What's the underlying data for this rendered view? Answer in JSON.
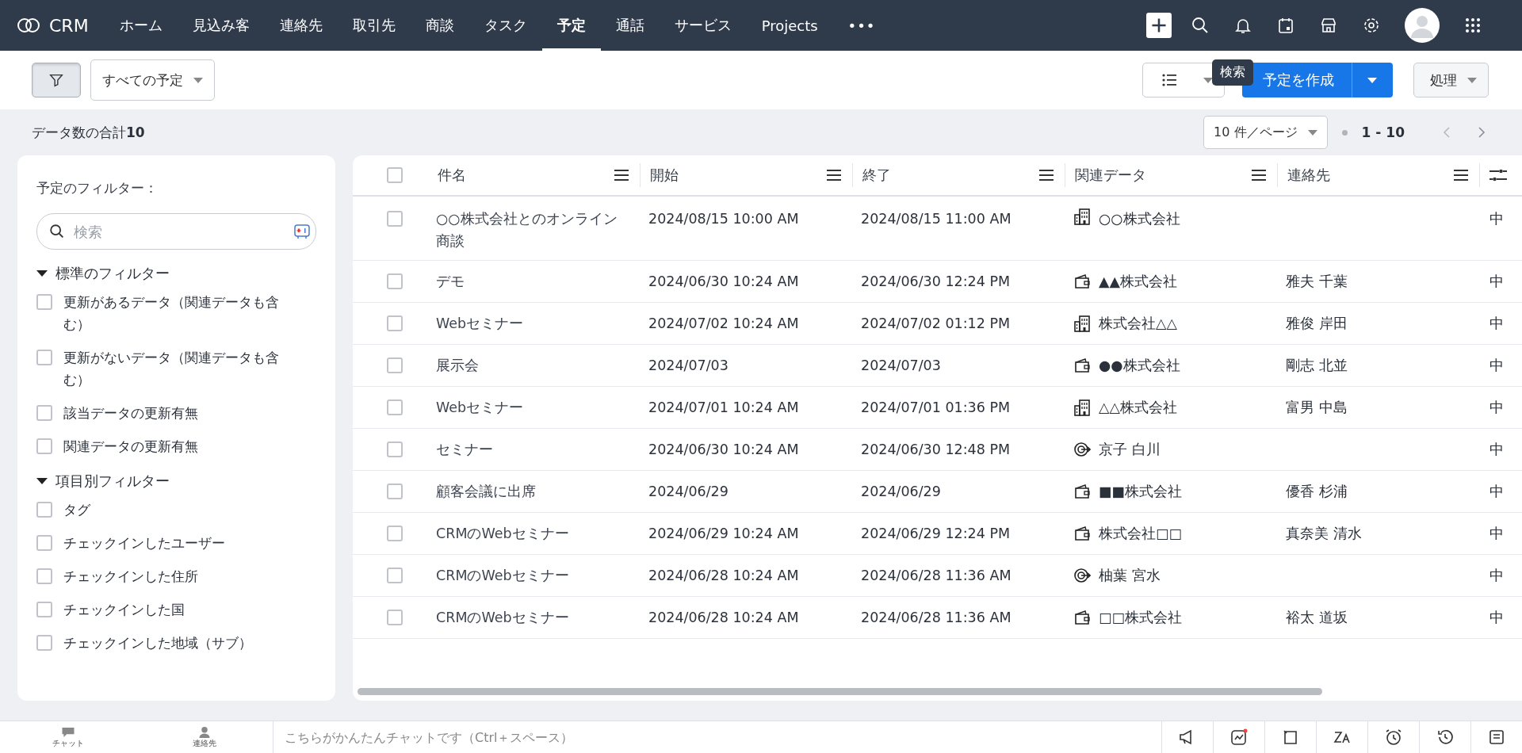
{
  "nav": {
    "logo": "CRM",
    "items": [
      {
        "label": "ホーム",
        "selected": false
      },
      {
        "label": "見込み客",
        "selected": false
      },
      {
        "label": "連絡先",
        "selected": false
      },
      {
        "label": "取引先",
        "selected": false
      },
      {
        "label": "商談",
        "selected": false
      },
      {
        "label": "タスク",
        "selected": false
      },
      {
        "label": "予定",
        "selected": true
      },
      {
        "label": "通話",
        "selected": false
      },
      {
        "label": "サービス",
        "selected": false
      },
      {
        "label": "Projects",
        "selected": false
      }
    ],
    "more": "•••"
  },
  "toolbar": {
    "view_select": "すべての予定",
    "tooltip": "検索",
    "create_button": "予定を作成",
    "actions_button": "処理"
  },
  "summary": {
    "label": "データ数の合計",
    "count": "10",
    "per_page": "10 件／ページ",
    "range": "1 - 10"
  },
  "sidebar": {
    "title": "予定のフィルター：",
    "search": {
      "placeholder": "検索"
    },
    "sections": [
      {
        "title": "標準のフィルター",
        "expanded": true,
        "items": [
          {
            "label": "更新があるデータ（関連データも含む）",
            "checked": false
          },
          {
            "label": "更新がないデータ（関連データも含む）",
            "checked": false
          },
          {
            "label": "該当データの更新有無",
            "checked": false
          },
          {
            "label": "関連データの更新有無",
            "checked": false
          }
        ]
      },
      {
        "title": "項目別フィルター",
        "expanded": true,
        "items": [
          {
            "label": "タグ",
            "checked": false
          },
          {
            "label": "チェックインしたユーザー",
            "checked": false
          },
          {
            "label": "チェックインした住所",
            "checked": false
          },
          {
            "label": "チェックインした国",
            "checked": false
          },
          {
            "label": "チェックインした地域（サブ）",
            "checked": false
          }
        ]
      }
    ]
  },
  "table": {
    "columns": [
      "件名",
      "開始",
      "終了",
      "関連データ",
      "連絡先"
    ],
    "all_checked": false,
    "rows": [
      {
        "checked": false,
        "title": "○○株式会社とのオンライン商談",
        "start": "2024/08/15 10:00 AM",
        "end": "2024/08/15 11:00 AM",
        "related": {
          "kind": "building",
          "label": "○○株式会社"
        },
        "contact": "",
        "column_7": "中"
      },
      {
        "checked": false,
        "title": "デモ",
        "start": "2024/06/30 10:24 AM",
        "end": "2024/06/30 12:24 PM",
        "related": {
          "kind": "wallet",
          "label": "▲▲株式会社"
        },
        "contact": "雅夫 千葉",
        "column_7": "中"
      },
      {
        "checked": false,
        "title": "Webセミナー",
        "start": "2024/07/02 10:24 AM",
        "end": "2024/07/02 01:12 PM",
        "related": {
          "kind": "building",
          "label": "株式会社△△"
        },
        "contact": "雅俊 岸田",
        "column_7": "中"
      },
      {
        "checked": false,
        "title": "展示会",
        "start": "2024/07/03",
        "end": "2024/07/03",
        "related": {
          "kind": "wallet",
          "label": "●●株式会社"
        },
        "contact": "剛志 北並",
        "column_7": "中"
      },
      {
        "checked": false,
        "title": "Webセミナー",
        "start": "2024/07/01 10:24 AM",
        "end": "2024/07/01 01:36 PM",
        "related": {
          "kind": "building",
          "label": "△△株式会社"
        },
        "contact": "富男 中島",
        "column_7": "中"
      },
      {
        "checked": false,
        "title": "セミナー",
        "start": "2024/06/30 10:24 AM",
        "end": "2024/06/30 12:48 PM",
        "related": {
          "kind": "target",
          "label": "京子 白川"
        },
        "contact": "",
        "column_7": "中"
      },
      {
        "checked": false,
        "title": "顧客会議に出席",
        "start": "2024/06/29",
        "end": "2024/06/29",
        "related": {
          "kind": "wallet",
          "label": "■■株式会社"
        },
        "contact": "優香 杉浦",
        "column_7": "中"
      },
      {
        "checked": false,
        "title": "CRMのWebセミナー",
        "start": "2024/06/29 10:24 AM",
        "end": "2024/06/29 12:24 PM",
        "related": {
          "kind": "wallet",
          "label": "株式会社□□"
        },
        "contact": "真奈美 清水",
        "column_7": "中"
      },
      {
        "checked": false,
        "title": "CRMのWebセミナー",
        "start": "2024/06/28 10:24 AM",
        "end": "2024/06/28 11:36 AM",
        "related": {
          "kind": "target",
          "label": "柚葉 宮水"
        },
        "contact": "",
        "column_7": "中"
      },
      {
        "checked": false,
        "title": "CRMのWebセミナー",
        "start": "2024/06/28 10:24 AM",
        "end": "2024/06/28 11:36 AM",
        "related": {
          "kind": "wallet",
          "label": "□□株式会社"
        },
        "contact": "裕太 道坂",
        "column_7": "中"
      }
    ]
  },
  "bottom_bar": {
    "chat_label": "チャット",
    "contacts_label": "連絡先",
    "chat_placeholder": "こちらがかんたんチャットです（Ctrl＋スペース）"
  }
}
